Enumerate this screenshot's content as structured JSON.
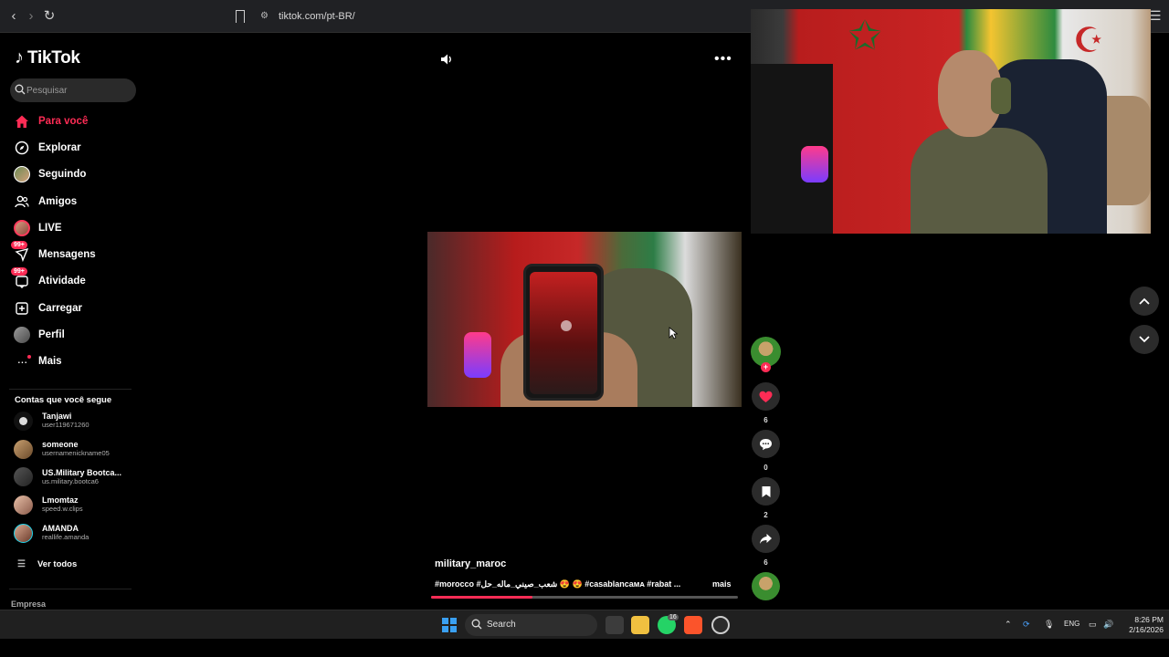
{
  "browser": {
    "url": "tiktok.com/pt-BR/"
  },
  "brand": {
    "name": "TikTok",
    "accent": "#fe2c55"
  },
  "search": {
    "placeholder": "Pesquisar"
  },
  "nav": [
    {
      "label": "Para você",
      "icon": "home-icon",
      "active": true
    },
    {
      "label": "Explorar",
      "icon": "compass-icon"
    },
    {
      "label": "Seguindo",
      "icon": "following-avatar-icon"
    },
    {
      "label": "Amigos",
      "icon": "friends-icon"
    },
    {
      "label": "LIVE",
      "icon": "live-icon"
    },
    {
      "label": "Mensagens",
      "icon": "messages-icon",
      "badge": "99+"
    },
    {
      "label": "Atividade",
      "icon": "activity-icon",
      "badge": "99+"
    },
    {
      "label": "Carregar",
      "icon": "upload-icon"
    },
    {
      "label": "Perfil",
      "icon": "profile-avatar-icon"
    },
    {
      "label": "Mais",
      "icon": "more-icon"
    }
  ],
  "following": {
    "heading": "Contas que você segue",
    "accounts": [
      {
        "name": "Tanjawi",
        "username": "user119671260"
      },
      {
        "name": "someone",
        "username": "usernamenickname05"
      },
      {
        "name": "US.Military Bootca...",
        "username": "us.military.bootca6"
      },
      {
        "name": "Lmomtaz",
        "username": "speed.w.clips"
      },
      {
        "name": "AMANDA",
        "username": "reallife.amanda"
      }
    ],
    "see_all": "Ver todos"
  },
  "footer": {
    "company": "Empresa"
  },
  "video": {
    "author": "military_maroc",
    "caption": "#morocco #شعب_صيني_ماله_حل 😍 😍 #casablancaᴍᴀ #rabat ...",
    "more": "mais",
    "progress": 0.33
  },
  "actions": {
    "likes": "6",
    "comments": "0",
    "saves": "2",
    "shares": "6"
  },
  "taskbar": {
    "search_label": "Search",
    "whatsapp_badge": "16",
    "language": "ENG",
    "time": "8:26 PM",
    "date": "2/16/2026"
  }
}
